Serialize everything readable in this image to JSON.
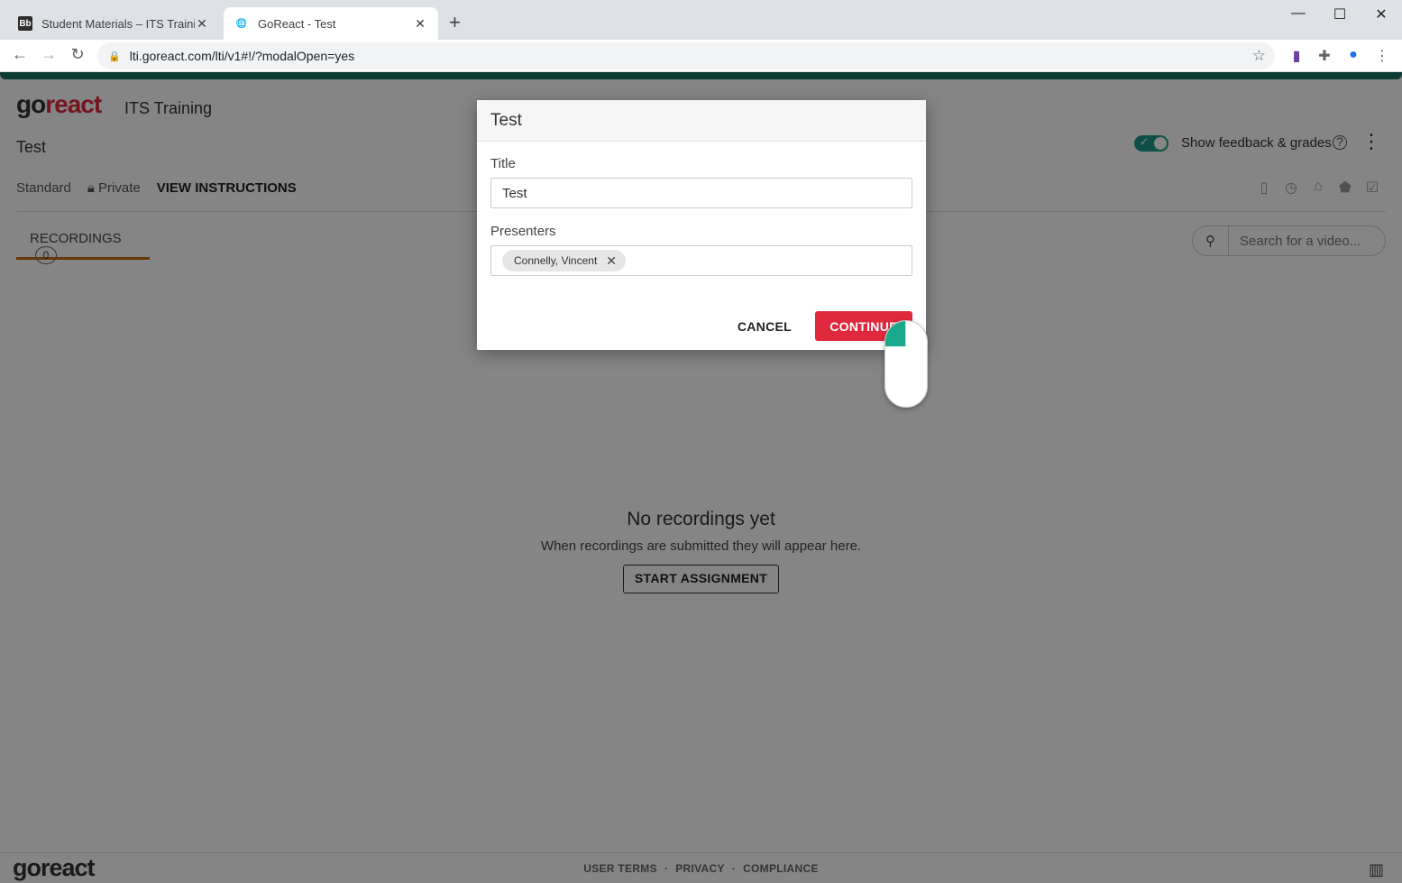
{
  "browser": {
    "tabs": [
      {
        "label": "Student Materials – ITS Training",
        "favicon": "Bb"
      },
      {
        "label": "GoReact - Test"
      }
    ],
    "url": "lti.goreact.com/lti/v1#!/?modalOpen=yes"
  },
  "app": {
    "logo_go": "go",
    "logo_react": "react",
    "course": "ITS Training",
    "assignment_title": "Test",
    "meta": {
      "type": "Standard",
      "privacy": "Private",
      "view_instructions": "VIEW INSTRUCTIONS"
    },
    "feedback_toggle_label": "Show feedback & grades",
    "recordings_tab": "RECORDINGS",
    "recordings_count": "0",
    "search_placeholder": "Search for a video...",
    "empty": {
      "heading": "No recordings yet",
      "message": "When recordings are submitted they will appear here.",
      "button": "START ASSIGNMENT"
    },
    "footer": {
      "user_terms": "USER TERMS",
      "privacy": "PRIVACY",
      "compliance": "COMPLIANCE"
    }
  },
  "modal": {
    "title": "Test",
    "title_label": "Title",
    "title_value": "Test",
    "presenters_label": "Presenters",
    "presenters": [
      "Connelly, Vincent"
    ],
    "cancel": "CANCEL",
    "continue": "CONTINUE"
  },
  "colors": {
    "accent": "#1b7466",
    "brand_red": "#e0293f",
    "toggle": "#1b9a85",
    "tab_underline": "#c96a12"
  }
}
